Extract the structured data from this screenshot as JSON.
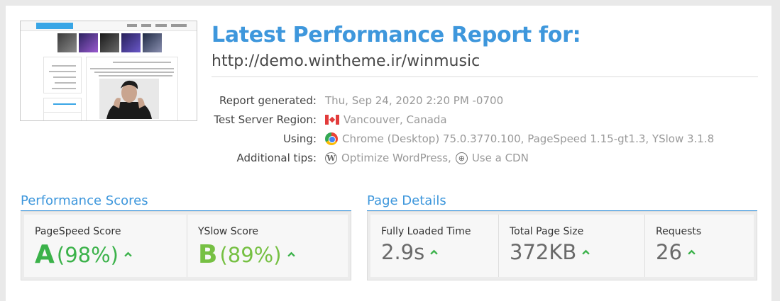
{
  "report": {
    "title": "Latest Performance Report for:",
    "url": "http://demo.wintheme.ir/winmusic"
  },
  "info": [
    {
      "label": "Report generated:",
      "value": "Thu, Sep 24, 2020 2:20 PM -0700"
    },
    {
      "label": "Test Server Region:",
      "value": "Vancouver, Canada",
      "icon": "canada-flag-icon"
    },
    {
      "label": "Using:",
      "value": "Chrome (Desktop) 75.0.3770.100, PageSpeed 1.15-gt1.3, YSlow 3.1.8",
      "icon": "chrome-icon"
    },
    {
      "label": "Additional tips:",
      "tip1": "Optimize WordPress,",
      "tip2": "Use a CDN",
      "icon1": "wordpress-icon",
      "icon2": "globe-icon"
    }
  ],
  "performance": {
    "heading": "Performance Scores",
    "pagespeed": {
      "label": "PageSpeed Score",
      "grade": "A",
      "value": "(98%)",
      "color": "#3bb24a"
    },
    "yslow": {
      "label": "YSlow Score",
      "grade": "B",
      "value": "(89%)",
      "color": "#76c043"
    }
  },
  "details": {
    "heading": "Page Details",
    "load_time": {
      "label": "Fully Loaded Time",
      "value": "2.9s"
    },
    "page_size": {
      "label": "Total Page Size",
      "value": "372KB"
    },
    "requests": {
      "label": "Requests",
      "value": "26"
    }
  },
  "colors": {
    "accent": "#3e97dc",
    "up_arrow": "#3bb24a"
  }
}
